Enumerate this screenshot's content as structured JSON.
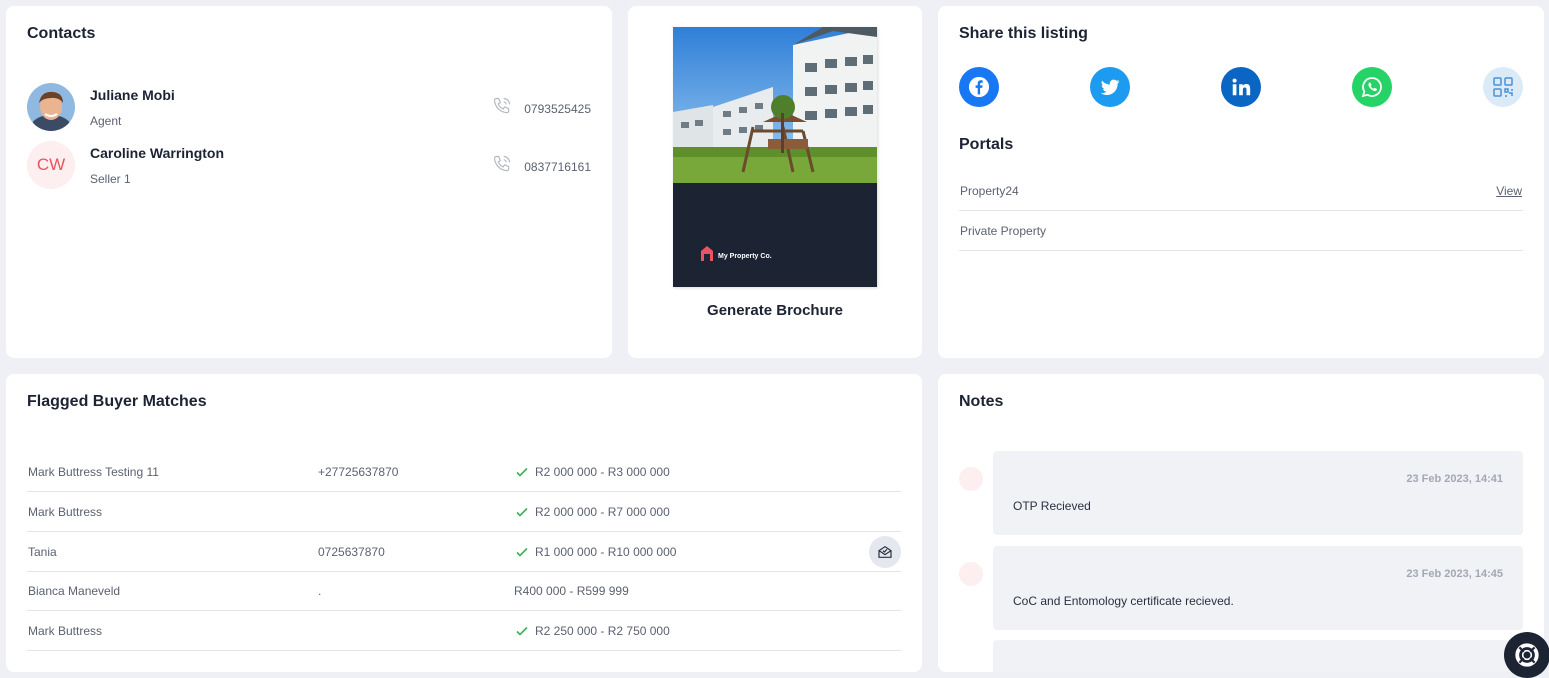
{
  "contacts": {
    "title": "Contacts",
    "items": [
      {
        "name": "Juliane Mobi",
        "role": "Agent",
        "phone": "0793525425",
        "avatar": "photo"
      },
      {
        "name": "Caroline Warrington",
        "role": "Seller 1",
        "phone": "0837716161",
        "initials": "CW"
      }
    ]
  },
  "brochure": {
    "brand": "My Property Co.",
    "label": "Generate Brochure"
  },
  "share": {
    "title": "Share this listing",
    "icons": [
      "facebook-icon",
      "twitter-icon",
      "linkedin-icon",
      "whatsapp-icon",
      "qr-code-icon"
    ],
    "colors": {
      "facebook": "#1877f2",
      "twitter": "#1d9bf0",
      "linkedin": "#0a66c2",
      "whatsapp": "#25d366",
      "qr": "#dbeaf7"
    },
    "portals_title": "Portals",
    "portals": [
      {
        "name": "Property24",
        "link": "View"
      },
      {
        "name": "Private Property",
        "link": ""
      }
    ]
  },
  "buyers": {
    "title": "Flagged Buyer Matches",
    "rows": [
      {
        "name": "Mark Buttress Testing 11",
        "phone": "+27725637870",
        "range": "R2 000 000 - R3 000 000",
        "checked": true
      },
      {
        "name": "Mark Buttress",
        "phone": "",
        "range": "R2 000 000 - R7 000 000",
        "checked": true
      },
      {
        "name": "Tania",
        "phone": "0725637870",
        "range": "R1 000 000 - R10 000 000",
        "checked": true
      },
      {
        "name": "Bianca Maneveld",
        "phone": ".",
        "range": "R400 000 - R599 999",
        "checked": false
      },
      {
        "name": "Mark Buttress",
        "phone": "",
        "range": "R2 250 000 - R2 750 000",
        "checked": true
      }
    ]
  },
  "notes": {
    "title": "Notes",
    "items": [
      {
        "timestamp": "23 Feb 2023, 14:41",
        "text": "OTP Recieved"
      },
      {
        "timestamp": "23 Feb 2023, 14:45",
        "text": "CoC and Entomology certificate recieved."
      }
    ]
  },
  "accent_color": "#e8545f"
}
